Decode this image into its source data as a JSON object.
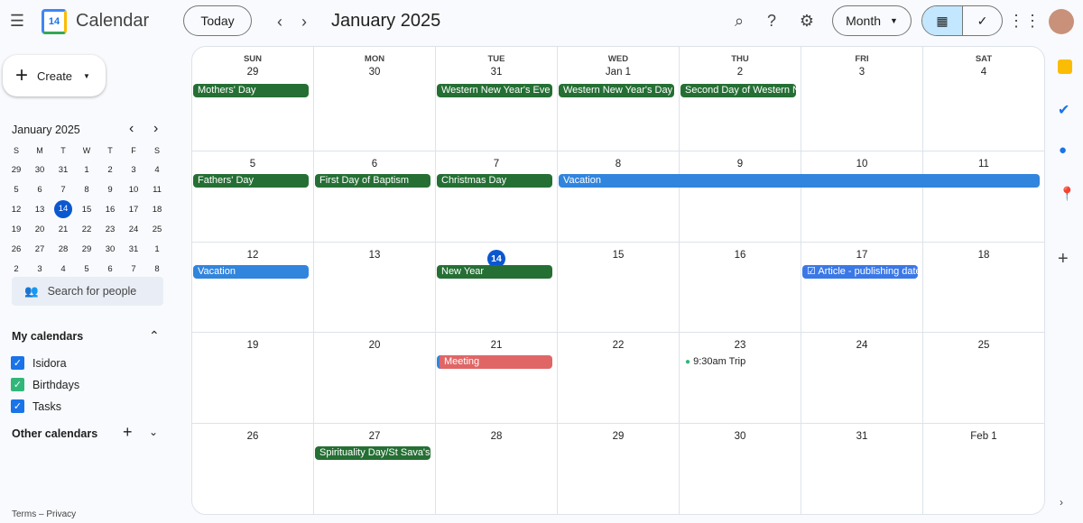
{
  "app": {
    "title": "Calendar",
    "logo_day": "14"
  },
  "toolbar": {
    "today": "Today",
    "period": "January 2025",
    "view": "Month",
    "prev_icon": "chevron-left-icon",
    "next_icon": "chevron-right-icon"
  },
  "create": {
    "label": "Create"
  },
  "mini": {
    "title": "January 2025",
    "dows": [
      "S",
      "M",
      "T",
      "W",
      "T",
      "F",
      "S"
    ],
    "weeks": [
      [
        "29",
        "30",
        "31",
        "1",
        "2",
        "3",
        "4"
      ],
      [
        "5",
        "6",
        "7",
        "8",
        "9",
        "10",
        "11"
      ],
      [
        "12",
        "13",
        "14",
        "15",
        "16",
        "17",
        "18"
      ],
      [
        "19",
        "20",
        "21",
        "22",
        "23",
        "24",
        "25"
      ],
      [
        "26",
        "27",
        "28",
        "29",
        "30",
        "31",
        "1"
      ],
      [
        "2",
        "3",
        "4",
        "5",
        "6",
        "7",
        "8"
      ]
    ],
    "selected": "14"
  },
  "search_people": "Search for people",
  "my_calendars": {
    "title": "My calendars",
    "items": [
      {
        "label": "Isidora",
        "color": "#1a73e8"
      },
      {
        "label": "Birthdays",
        "color": "#33b679"
      },
      {
        "label": "Tasks",
        "color": "#1a73e8"
      }
    ]
  },
  "other_calendars": {
    "title": "Other calendars"
  },
  "footer": {
    "terms": "Terms",
    "sep": "–",
    "privacy": "Privacy"
  },
  "colors": {
    "holiday": "#256f34",
    "vacation": "#3185dd",
    "task": "#3b78e7",
    "meeting": "#e06666",
    "today": "#0b57d0",
    "trip": "#33b679"
  },
  "grid": {
    "dows": [
      "SUN",
      "MON",
      "TUE",
      "WED",
      "THU",
      "FRI",
      "SAT"
    ],
    "weeks": [
      {
        "days": [
          "29",
          "30",
          "31",
          "Jan 1",
          "2",
          "3",
          "4"
        ],
        "events": [
          {
            "label": "Mothers' Day",
            "day": 0,
            "span": 1,
            "kind": "holiday"
          },
          {
            "label": "Western New Year's Eve",
            "day": 2,
            "span": 1,
            "kind": "holiday"
          },
          {
            "label": "Western New Year's Day",
            "day": 3,
            "span": 1,
            "kind": "holiday"
          },
          {
            "label": "Second Day of Western New Year",
            "day": 4,
            "span": 1,
            "kind": "holiday"
          }
        ]
      },
      {
        "days": [
          "5",
          "6",
          "7",
          "8",
          "9",
          "10",
          "11"
        ],
        "events": [
          {
            "label": "Fathers' Day",
            "day": 0,
            "span": 1,
            "kind": "holiday"
          },
          {
            "label": "First Day of Baptism",
            "day": 1,
            "span": 1,
            "kind": "holiday"
          },
          {
            "label": "Christmas Day",
            "day": 2,
            "span": 1,
            "kind": "holiday"
          },
          {
            "label": "Vacation",
            "day": 3,
            "span": 4,
            "kind": "vacation"
          }
        ]
      },
      {
        "days": [
          "12",
          "13",
          "14",
          "15",
          "16",
          "17",
          "18"
        ],
        "today": 2,
        "events": [
          {
            "label": "Vacation",
            "day": 0,
            "span": 1,
            "kind": "vacation"
          },
          {
            "label": "New Year",
            "day": 2,
            "span": 1,
            "kind": "holiday"
          },
          {
            "label": "Article - publishing date",
            "day": 5,
            "span": 1,
            "kind": "task"
          }
        ]
      },
      {
        "days": [
          "19",
          "20",
          "21",
          "22",
          "23",
          "24",
          "25"
        ],
        "events": [
          {
            "label": "Meeting",
            "day": 2,
            "span": 1,
            "kind": "meeting"
          },
          {
            "label": "Trip",
            "time": "9:30am",
            "day": 4,
            "span": 1,
            "kind": "trip"
          }
        ]
      },
      {
        "days": [
          "26",
          "27",
          "28",
          "29",
          "30",
          "31",
          "Feb 1"
        ],
        "events": [
          {
            "label": "Spirituality Day/St Sava's Day",
            "day": 1,
            "span": 1,
            "kind": "holiday"
          }
        ]
      }
    ]
  }
}
